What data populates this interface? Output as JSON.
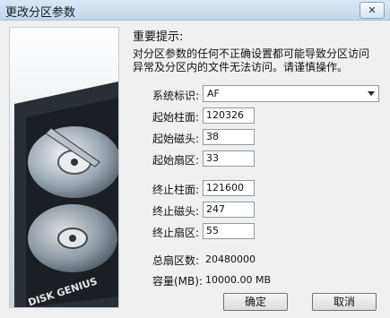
{
  "window": {
    "title": "更改分区参数",
    "close_glyph": "✕"
  },
  "art": {
    "brand_text": "DISK GENIUS"
  },
  "notice": {
    "heading": "重要提示:",
    "body": "对分区参数的任何不正确设置都可能导致分区访问异常及分区内的文件无法访问。请谨慎操作。"
  },
  "fields": {
    "system_id": {
      "label": "系统标识:",
      "value": "AF"
    },
    "start_cylinder": {
      "label": "起始柱面:",
      "value": "120326"
    },
    "start_head": {
      "label": "起始磁头:",
      "value": "38"
    },
    "start_sector": {
      "label": "起始扇区:",
      "value": "33"
    },
    "end_cylinder": {
      "label": "终止柱面:",
      "value": "121600"
    },
    "end_head": {
      "label": "终止磁头:",
      "value": "247"
    },
    "end_sector": {
      "label": "终止扇区:",
      "value": "55"
    },
    "total_sectors": {
      "label": "总扇区数:",
      "value": "20480000"
    },
    "capacity": {
      "label": "容量(MB):",
      "value": "10000.00 MB"
    }
  },
  "buttons": {
    "ok": "确定",
    "cancel": "取消"
  },
  "colors": {
    "title_bar": "#c3d5ea",
    "dialog_bg": "#f0f0f0"
  }
}
